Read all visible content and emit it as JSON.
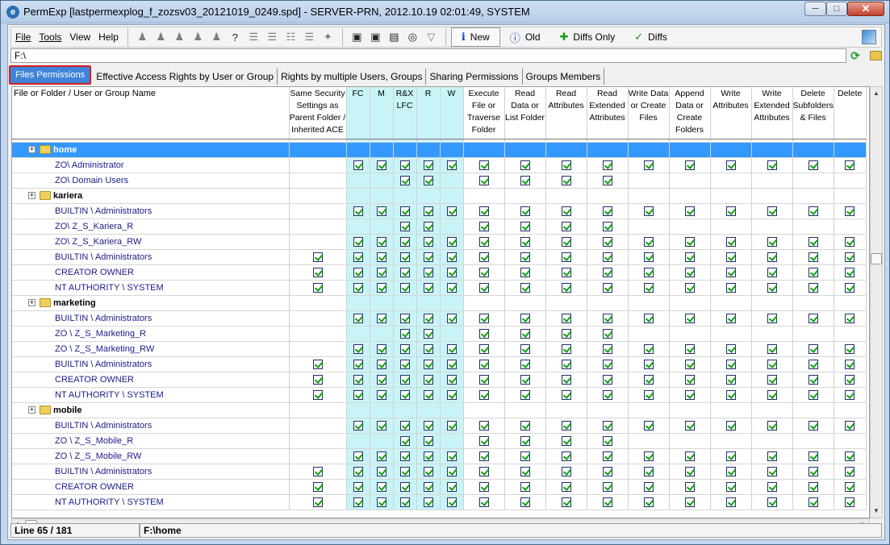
{
  "window": {
    "title": "PermExp [lastpermexplog_f_zozsv03_20121019_0249.spd] - SERVER-PRN, 2012.10.19   02:01:49, SYSTEM",
    "min_glyph": "─",
    "max_glyph": "□",
    "close_glyph": "✕"
  },
  "menu": [
    "File",
    "Tools",
    "View",
    "Help"
  ],
  "toolbar": {
    "icons": [
      "user-icon",
      "users-icon",
      "users-crossed-icon",
      "users-x-icon",
      "users-strike-icon",
      "help-icon",
      "list-color-icon",
      "list-icon",
      "tree-green-icon",
      "list-gray-icon",
      "tools-icon"
    ],
    "icons2": [
      "compare-icon",
      "compare-add-icon",
      "lock-folder-icon",
      "binoculars-icon",
      "filter-icon"
    ],
    "view_buttons": [
      {
        "label": "New",
        "icon": "info-icon",
        "glyph": "ℹ",
        "color": "#1a3fbf"
      },
      {
        "label": "Old",
        "icon": "info-old-icon",
        "glyph": "ⓘ",
        "color": "#1a3fbf"
      },
      {
        "label": "Diffs Only",
        "icon": "plus-green-icon",
        "glyph": "✚",
        "color": "#1a9a1a"
      },
      {
        "label": "Diffs",
        "icon": "check-diff-icon",
        "glyph": "✓",
        "color": "#1a8a1a"
      }
    ]
  },
  "path": "F:\\",
  "tabs": [
    "Files Permissions",
    "Effective Access Rights by User or Group",
    "Rights by multiple Users, Groups",
    "Sharing Permissions",
    "Groups Members"
  ],
  "table": {
    "headers": [
      "File or Folder / User or Group Name",
      "Same Security Settings as Parent Folder / Inherited ACE",
      "FC",
      "M",
      "R&X LFC",
      "R",
      "W",
      "Execute File or Traverse Folder",
      "Read Data or List Folder",
      "Read Attributes",
      "Read Extended Attributes",
      "Write Data or Create Files",
      "Append Data or Create Folders",
      "Write Attributes",
      "Write Extended Attributes",
      "Delete Subfolders & Files",
      "Delete"
    ],
    "rows": [
      {
        "name": "home",
        "type": "folder",
        "selected": true,
        "checks": ""
      },
      {
        "name": "ZO\\ Administrator",
        "type": "entry",
        "checks": "0111111111111111"
      },
      {
        "name": "ZO\\ Domain Users",
        "type": "entry",
        "checks": "0001101111000000"
      },
      {
        "name": "kariera",
        "type": "folder",
        "checks": ""
      },
      {
        "name": "BUILTIN \\ Administrators",
        "type": "entry",
        "checks": "0111111111111111"
      },
      {
        "name": "ZO\\ Z_S_Kariera_R",
        "type": "entry",
        "checks": "0001101111000000"
      },
      {
        "name": "ZO\\ Z_S_Kariera_RW",
        "type": "entry",
        "checks": "0111111111111111"
      },
      {
        "name": "BUILTIN \\ Administrators",
        "type": "entry",
        "checks": "1111111111111111"
      },
      {
        "name": "CREATOR OWNER",
        "type": "entry",
        "checks": "1111111111111111"
      },
      {
        "name": "NT AUTHORITY \\ SYSTEM",
        "type": "entry",
        "checks": "1111111111111111"
      },
      {
        "name": "marketing",
        "type": "folder",
        "checks": ""
      },
      {
        "name": "BUILTIN \\ Administrators",
        "type": "entry",
        "checks": "0111111111111111"
      },
      {
        "name": "ZO \\ Z_S_Marketing_R",
        "type": "entry",
        "checks": "0001101111000000"
      },
      {
        "name": "ZO \\ Z_S_Marketing_RW",
        "type": "entry",
        "checks": "0111111111111111"
      },
      {
        "name": "BUILTIN \\ Administrators",
        "type": "entry",
        "checks": "1111111111111111"
      },
      {
        "name": "CREATOR OWNER",
        "type": "entry",
        "checks": "1111111111111111"
      },
      {
        "name": "NT AUTHORITY \\ SYSTEM",
        "type": "entry",
        "checks": "1111111111111111"
      },
      {
        "name": "mobile",
        "type": "folder",
        "checks": ""
      },
      {
        "name": "BUILTIN \\ Administrators",
        "type": "entry",
        "checks": "0111111111111111"
      },
      {
        "name": "ZO \\ Z_S_Mobile_R",
        "type": "entry",
        "checks": "0001101111000000"
      },
      {
        "name": "ZO \\ Z_S_Mobile_RW",
        "type": "entry",
        "checks": "0111111111111111"
      },
      {
        "name": "BUILTIN \\ Administrators",
        "type": "entry",
        "checks": "1111111111111111"
      },
      {
        "name": "CREATOR OWNER",
        "type": "entry",
        "checks": "1111111111111111"
      },
      {
        "name": "NT AUTHORITY \\ SYSTEM",
        "type": "entry",
        "checks": "1111111111111111"
      }
    ]
  },
  "status": {
    "line": "Line 65 / 181",
    "path": "F:\\home"
  }
}
